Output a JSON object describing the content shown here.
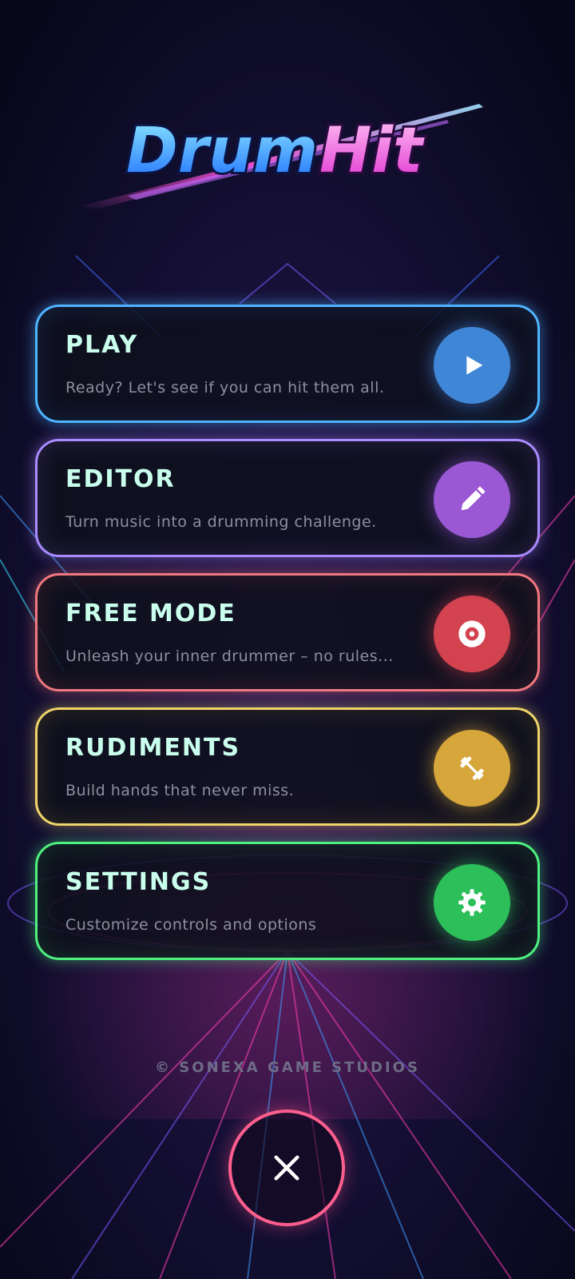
{
  "app": {
    "logo_text_part1": "Drum",
    "logo_text_part2": "Hit"
  },
  "menu": [
    {
      "id": "play",
      "title": "PLAY",
      "description": "Ready? Let's see if you can hit them all.",
      "icon": "play-icon",
      "color": "#4fb4ff"
    },
    {
      "id": "editor",
      "title": "EDITOR",
      "description": "Turn music into a drumming challenge.",
      "icon": "pencil-icon",
      "color": "#a98bff"
    },
    {
      "id": "free",
      "title": "FREE MODE",
      "description": "Unleash your inner drummer – no rules...",
      "icon": "drum-target-icon",
      "color": "#f0787e"
    },
    {
      "id": "rudiments",
      "title": "RUDIMENTS",
      "description": "Build hands that never miss.",
      "icon": "dumbbell-icon",
      "color": "#f0d56a"
    },
    {
      "id": "settings",
      "title": "SETTINGS",
      "description": "Customize controls and options",
      "icon": "gear-icon",
      "color": "#4ef07f"
    }
  ],
  "footer": {
    "copyright": "© SONEXA GAME STUDIOS",
    "close_icon": "close-icon",
    "close_color": "#ff5f8e"
  }
}
